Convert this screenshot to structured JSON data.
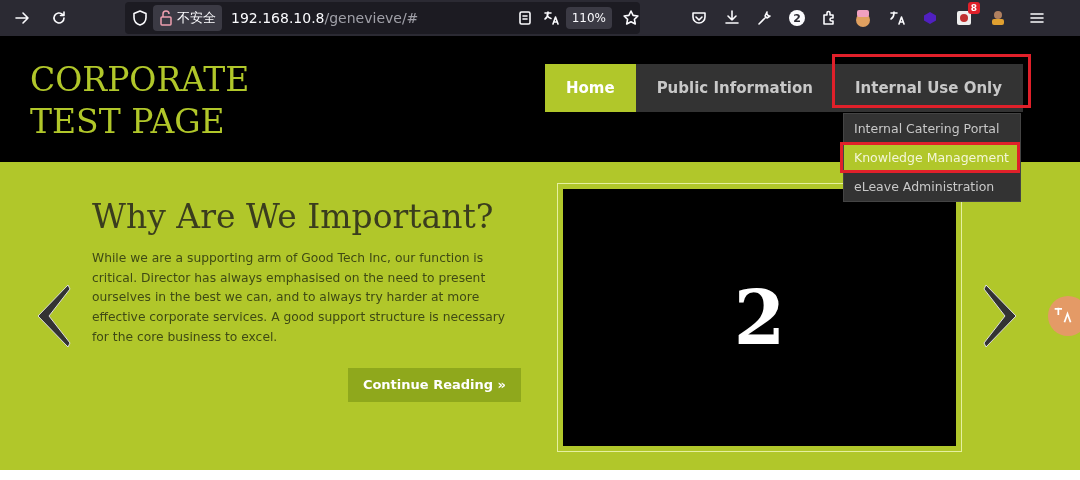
{
  "browser": {
    "security_label": "不安全",
    "url_host": "192.168.10.8",
    "url_path": "/genevieve/#",
    "zoom": "110%",
    "count_badge": "2",
    "notification_badge": "8"
  },
  "site": {
    "title_lines": [
      "CORPORATE",
      "TEST PAGE"
    ],
    "nav": [
      {
        "label": "Home",
        "selected": true,
        "highlighted": false
      },
      {
        "label": "Public Information",
        "selected": false,
        "highlighted": false
      },
      {
        "label": "Internal Use Only",
        "selected": false,
        "highlighted": true,
        "expanded": true,
        "menu": [
          {
            "label": "Internal Catering Portal",
            "selected": false,
            "highlighted": false
          },
          {
            "label": "Knowledge Management",
            "selected": true,
            "highlighted": true
          },
          {
            "label": "eLeave Administration",
            "selected": false,
            "highlighted": false
          }
        ]
      }
    ]
  },
  "hero": {
    "heading": "Why Are We Important?",
    "body": "While we are a supporting arm of Good Tech Inc, our function is critical. Director has always emphasised on the need to present ourselves in the best we can, and to always try harder at more effective corporate services. A good support structure is necessary for the core business to excel.",
    "button": "Continue Reading »",
    "slide_label": "2"
  }
}
